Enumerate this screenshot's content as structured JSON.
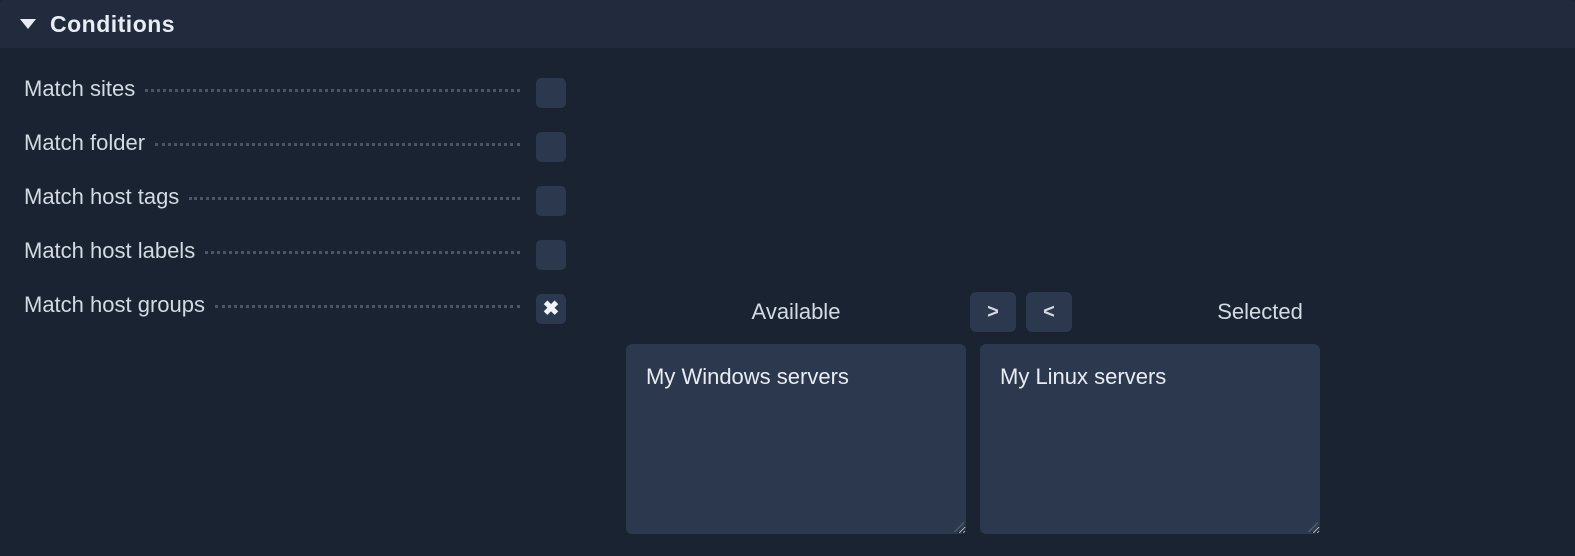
{
  "section": {
    "title": "Conditions"
  },
  "conditions": [
    {
      "label": "Match sites",
      "checked": false
    },
    {
      "label": "Match folder",
      "checked": false
    },
    {
      "label": "Match host tags",
      "checked": false
    },
    {
      "label": "Match host labels",
      "checked": false
    },
    {
      "label": "Match host groups",
      "checked": true
    }
  ],
  "dual": {
    "available_label": "Available",
    "selected_label": "Selected",
    "move_right": ">",
    "move_left": "<",
    "available_items": [
      "My Windows servers"
    ],
    "selected_items": [
      "My Linux servers"
    ]
  }
}
